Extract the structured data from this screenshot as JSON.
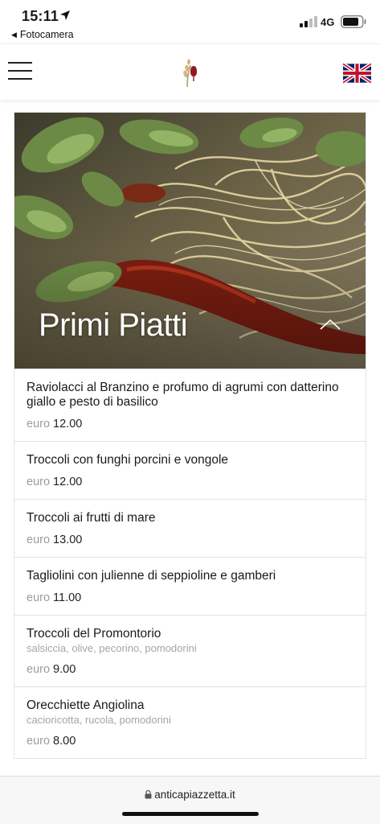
{
  "status_bar": {
    "time": "15:11",
    "back_app": "Fotocamera",
    "network": "4G"
  },
  "nav": {
    "menu_icon": "hamburger-menu-icon",
    "logo": "wheat-wine-logo",
    "language_flag": "uk-flag-icon"
  },
  "section": {
    "title": "Primi Piatti",
    "toggle_icon": "chevron-up-icon"
  },
  "currency_label": "euro",
  "menu_items": [
    {
      "name": "Raviolacci al Branzino e profumo di agrumi con datterino giallo e pesto di basilico",
      "desc": "",
      "price": "12.00"
    },
    {
      "name": "Troccoli con funghi porcini e vongole",
      "desc": "",
      "price": "12.00"
    },
    {
      "name": "Troccoli ai frutti di mare",
      "desc": "",
      "price": "13.00"
    },
    {
      "name": "Tagliolini con julienne di seppioline e gamberi",
      "desc": "",
      "price": "11.00"
    },
    {
      "name": "Troccoli del Promontorio",
      "desc": "salsiccia, olive, pecorino, pomodorini",
      "price": "9.00"
    },
    {
      "name": "Orecchiette Angiolina",
      "desc": "cacioricotta, rucola, pomodorini",
      "price": "8.00"
    }
  ],
  "browser": {
    "url": "anticapiazzetta.it"
  }
}
